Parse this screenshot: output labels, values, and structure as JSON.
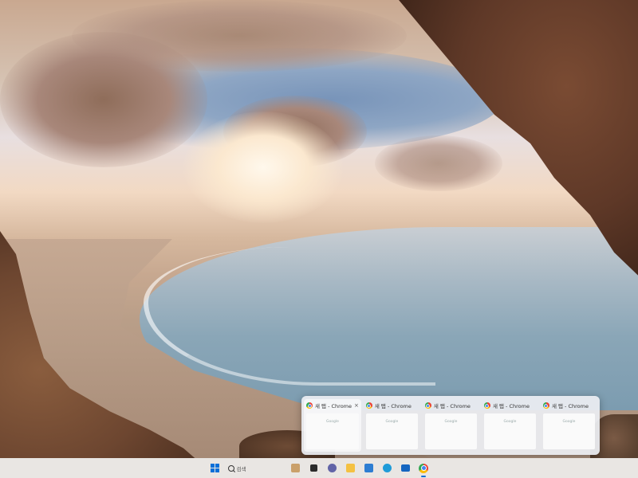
{
  "taskbar_preview": {
    "app": "Chrome",
    "windows": [
      {
        "title": "새 탭 - Chrome",
        "page_label": "Google",
        "active": true
      },
      {
        "title": "새 탭 - Chrome",
        "page_label": "Google",
        "active": false
      },
      {
        "title": "새 탭 - Chrome",
        "page_label": "Google",
        "active": false
      },
      {
        "title": "새 탭 - Chrome",
        "page_label": "Google",
        "active": false
      },
      {
        "title": "새 탭 - Chrome",
        "page_label": "Google",
        "active": false
      }
    ],
    "close_glyph": "×"
  },
  "taskbar": {
    "search_placeholder": "검색",
    "icons": [
      {
        "name": "start-icon"
      },
      {
        "name": "search-icon"
      },
      {
        "name": "widgets-icon",
        "color": "#caa06a"
      },
      {
        "name": "task-view-icon",
        "color": "#2b2b2b"
      },
      {
        "name": "chat-icon",
        "color": "#6264a7"
      },
      {
        "name": "file-explorer-icon",
        "color": "#f4c142"
      },
      {
        "name": "store-icon",
        "color": "#2d7dd2"
      },
      {
        "name": "edge-icon",
        "color": "#1f9bd8"
      },
      {
        "name": "mail-icon",
        "color": "#1565c0"
      },
      {
        "name": "chrome-icon"
      }
    ]
  }
}
